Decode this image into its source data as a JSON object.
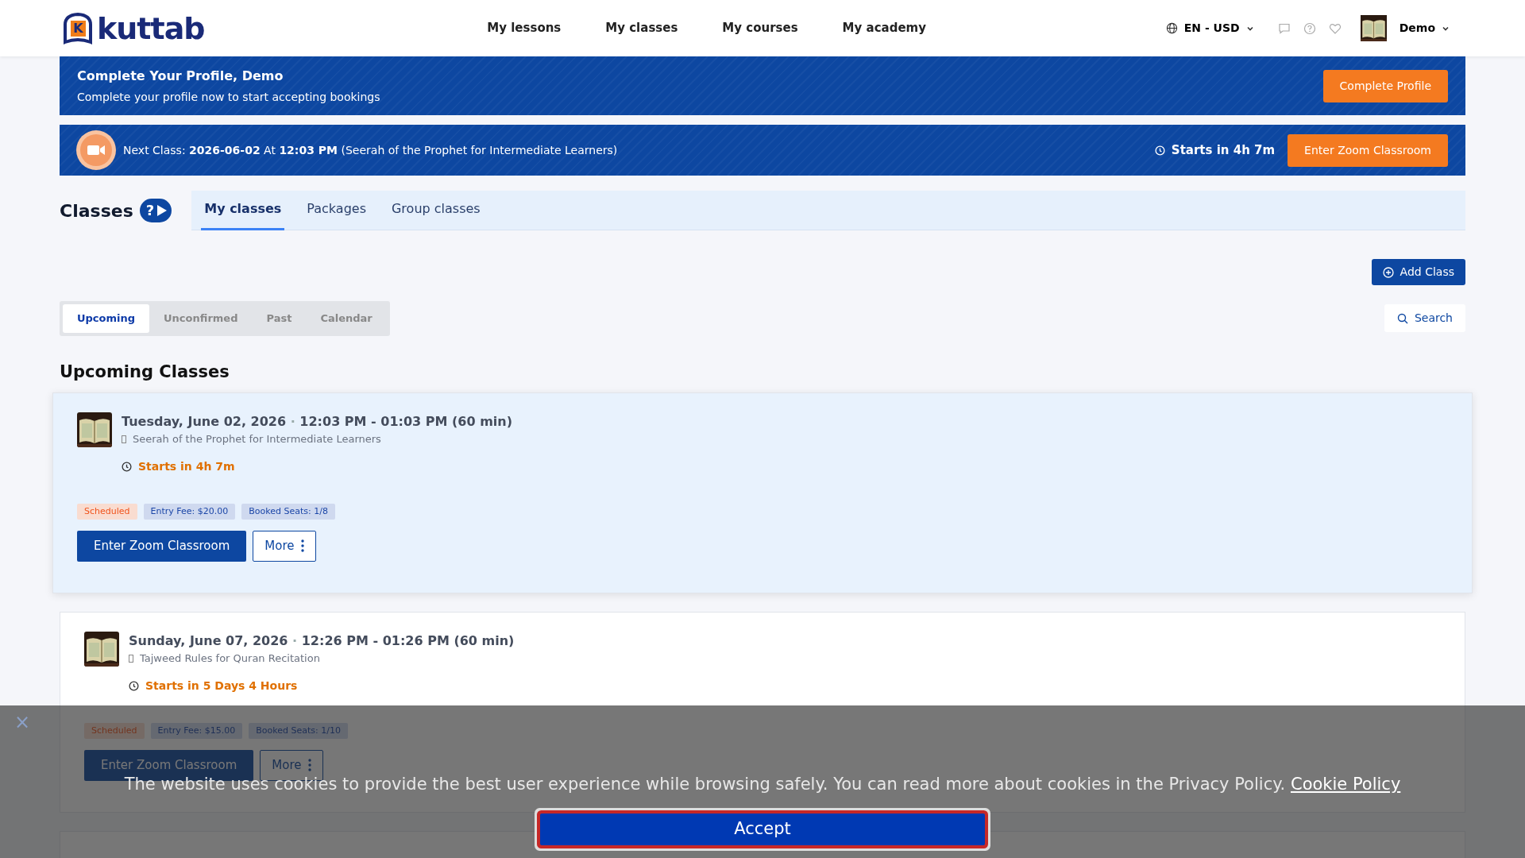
{
  "nav": {
    "logo_mark": "K",
    "logo": "kuttab",
    "links": [
      {
        "label": "My lessons"
      },
      {
        "label": "My classes"
      },
      {
        "label": "My courses"
      },
      {
        "label": "My academy"
      }
    ],
    "locale": "EN - USD",
    "user": "Demo"
  },
  "profile_banner": {
    "title": "Complete Your Profile, Demo",
    "text": "Complete your profile now to start accepting bookings",
    "button": "Complete Profile"
  },
  "next_class": {
    "text": "Next Class: **2026-06-02** At **12:03 PM** (Seerah of the Prophet for Intermediate Learners)",
    "countdown": "Starts in 4h 7m",
    "button": "Enter Zoom Classroom"
  },
  "page": {
    "title": "Classes",
    "help_glyph": "?",
    "tabs": [
      {
        "label": "My classes",
        "selected": true
      },
      {
        "label": "Packages",
        "selected": false
      },
      {
        "label": "Group classes",
        "selected": false
      }
    ],
    "add_button": "Add Class",
    "filters": [
      {
        "label": "Upcoming",
        "selected": true
      },
      {
        "label": "Unconfirmed",
        "selected": false
      },
      {
        "label": "Past",
        "selected": false
      },
      {
        "label": "Calendar",
        "selected": false
      }
    ],
    "search": "Search",
    "section_title": "Upcoming Classes"
  },
  "classes": [
    {
      "highlighted": true,
      "date": "Tuesday, June 02, 2026",
      "separator": "·",
      "time": "12:03 PM - 01:03 PM (60 min)",
      "course": "Seerah of the Prophet for Intermediate Learners",
      "countdown": "Starts in 4h 7m",
      "status": "Scheduled",
      "fee": "Entry Fee: $20.00",
      "seats": "Booked Seats: 1/8",
      "enter": "Enter Zoom Classroom",
      "more": "More"
    },
    {
      "highlighted": false,
      "date": "Sunday, June 07, 2026",
      "separator": "·",
      "time": "12:26 PM - 01:26 PM (60 min)",
      "course": "Tajweed Rules for Quran Recitation",
      "countdown": "Starts in 5 Days 4 Hours",
      "status": "Scheduled",
      "fee": "Entry Fee: $15.00",
      "seats": "Booked Seats: 1/10",
      "enter": "Enter Zoom Classroom",
      "more": "More"
    }
  ],
  "cookie": {
    "close": "×",
    "text": "The website uses cookies to provide the best user experience while browsing safely. You can read more about cookies in the Privacy Policy.",
    "link": "Cookie Policy",
    "button": "Accept"
  }
}
